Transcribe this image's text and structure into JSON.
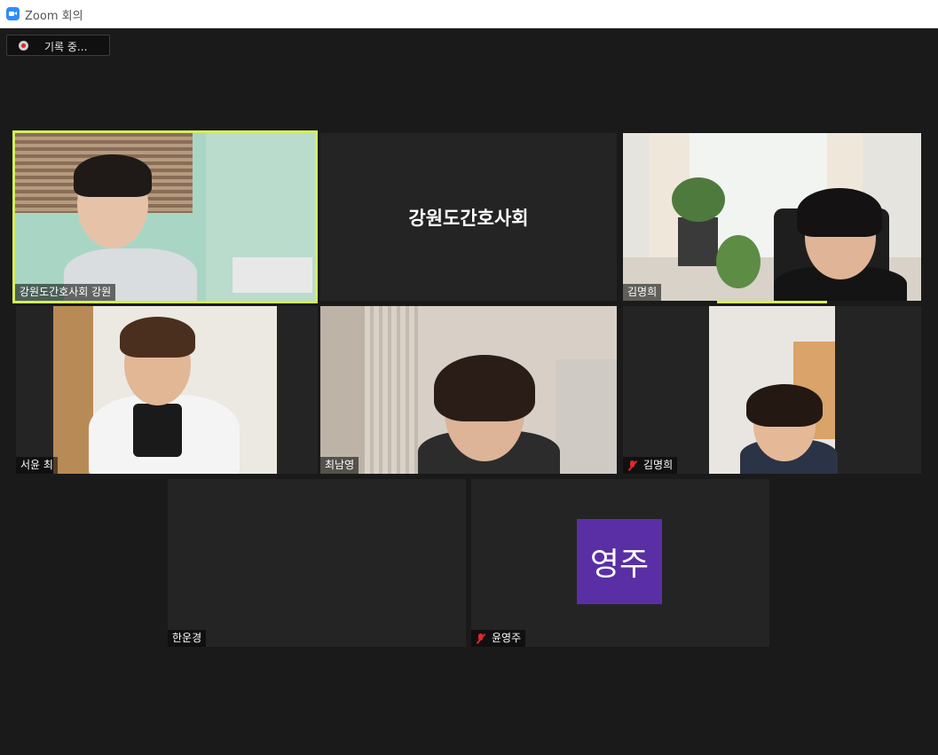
{
  "window": {
    "title": "Zoom 회의"
  },
  "recording": {
    "label": "기록 중..."
  },
  "participants": [
    {
      "name": "강원도간호사회 강원",
      "video": true,
      "muted": false,
      "active": true
    },
    {
      "name": "강원도간호사회",
      "video": false,
      "muted": false,
      "display_name": "강원도간호사회"
    },
    {
      "name": "김명희",
      "video": true,
      "muted": false
    },
    {
      "name": "서윤 최",
      "video": true,
      "muted": false
    },
    {
      "name": "최남영",
      "video": true,
      "muted": false
    },
    {
      "name": "김명희",
      "video": true,
      "muted": true
    },
    {
      "name": "한운경",
      "video": false,
      "muted": false
    },
    {
      "name": "윤영주",
      "video": false,
      "muted": true,
      "avatar_initials": "영주",
      "avatar_color": "#5a2fa5"
    }
  ],
  "colors": {
    "active_speaker_border": "#d4ee5c",
    "mute_icon": "#e02828",
    "background": "#1a1a1a"
  }
}
